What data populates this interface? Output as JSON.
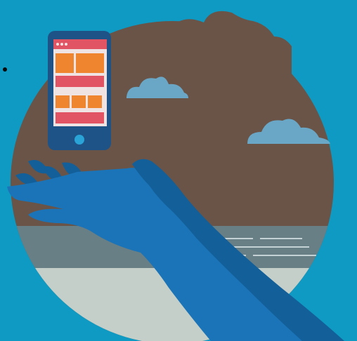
{
  "illustration": {
    "kind": "mobile responsive design illustration",
    "palette": {
      "background": "#0f9ac3",
      "circle": "#6a5447",
      "clouds": "#6aa6c5",
      "water": "#697f86",
      "foreground_ground": "#c4cfc9",
      "hand_light": "#1b74b7",
      "hand_dark": "#135f99",
      "phone_body": "#1d5387",
      "screen_blocks_orange": "#f0852f",
      "screen_blocks_pink": "#e05463",
      "screen_bg": "#f0e3e3",
      "home_button": "#2aa3d6"
    },
    "icons": [
      "phone-icon",
      "cloud-icon",
      "hand-icon",
      "plant-icon"
    ]
  }
}
